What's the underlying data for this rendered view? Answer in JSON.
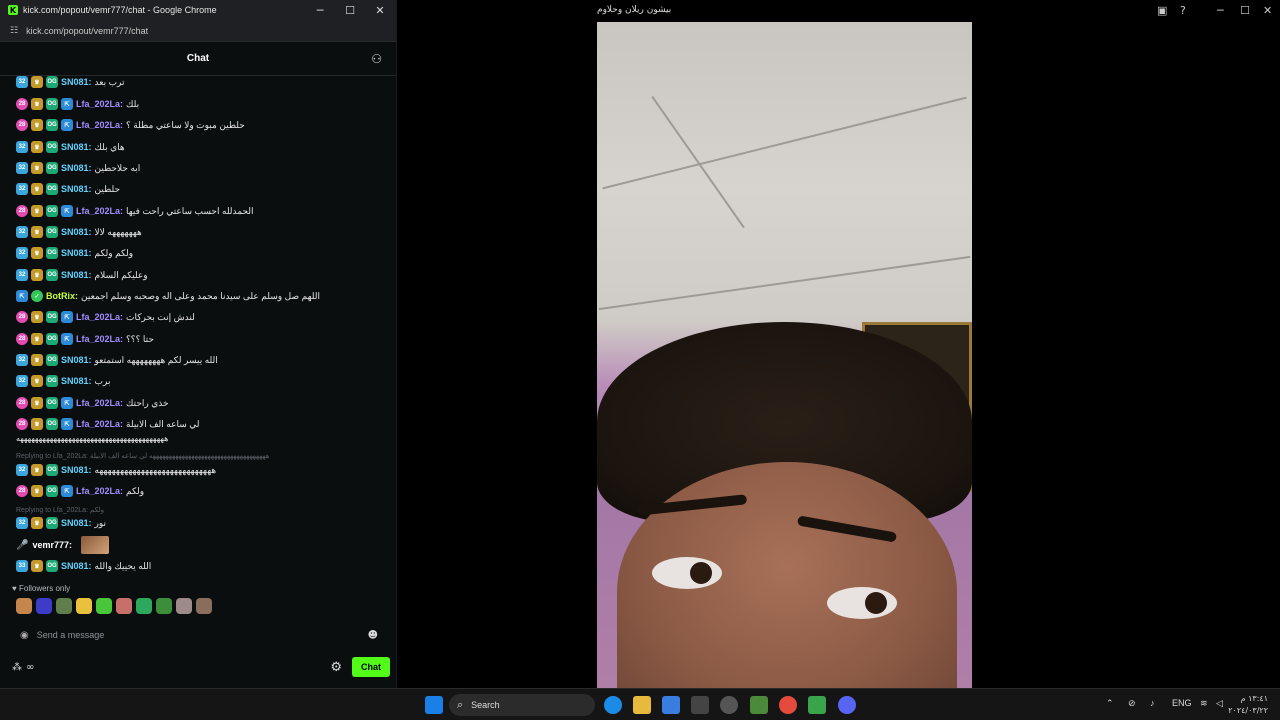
{
  "browser": {
    "title": "kick.com/popout/vemr777/chat - Google Chrome",
    "url": "kick.com/popout/vemr777/chat"
  },
  "chat": {
    "header": "Chat",
    "messages": [
      {
        "badge": "32",
        "user": "SN081:",
        "text": "ترب بعد",
        "type": "sno"
      },
      {
        "badge": "28",
        "user": "Lfa_202La:",
        "text": "بلك",
        "type": "lfa"
      },
      {
        "badge": "28",
        "user": "Lfa_202La:",
        "text": "حلطين مبوت ولا ساعتي مطلة ؟",
        "type": "lfa"
      },
      {
        "badge": "32",
        "user": "SN081:",
        "text": "هاي بلك",
        "type": "sno"
      },
      {
        "badge": "32",
        "user": "SN081:",
        "text": "ابه حلاحطين",
        "type": "sno"
      },
      {
        "badge": "32",
        "user": "SN081:",
        "text": "حلطين",
        "type": "sno"
      },
      {
        "badge": "28",
        "user": "Lfa_202La:",
        "text": "الحمدلله احسب ساعتي راحت فيها",
        "type": "lfa"
      },
      {
        "badge": "32",
        "user": "SN081:",
        "text": "هههههههه لالا",
        "type": "sno"
      },
      {
        "badge": "32",
        "user": "SN081:",
        "text": "ولكم ولكم",
        "type": "sno"
      },
      {
        "badge": "32",
        "user": "SN081:",
        "text": "وعليكم السلام",
        "type": "sno"
      },
      {
        "badge": "",
        "user": "BotRix:",
        "text": "اللهم صل وسلم على سيدنا محمد وعلى اله وصحبه وسلم اجمعين",
        "type": "bot"
      },
      {
        "badge": "28",
        "user": "Lfa_202La:",
        "text": "لندش إنت بحركات",
        "type": "lfa"
      },
      {
        "badge": "28",
        "user": "Lfa_202La:",
        "text": "حتا ؟؟؟",
        "type": "lfa"
      },
      {
        "badge": "32",
        "user": "SN081:",
        "text": "الله ييسر لكم ههههههههه استمتعو",
        "type": "sno"
      },
      {
        "badge": "32",
        "user": "SN081:",
        "text": "برب",
        "type": "sno"
      },
      {
        "badge": "28",
        "user": "Lfa_202La:",
        "text": "خذي راحتك",
        "type": "lfa"
      },
      {
        "badge": "28",
        "user": "Lfa_202La:",
        "text": "لي ساعه الف الابيلة",
        "type": "lfa"
      }
    ],
    "wrapped_line": "ههههههههههههههههههههههههههههههههههههههههه",
    "reply1": "Replying to Lfa_202La: ههههههههههههههههههههههههههههههههههههه لي ساعه الف الابيلة",
    "reply1_msg": {
      "badge": "32",
      "user": "SN081:",
      "text": "ههههههههههههههههههههههههههههه"
    },
    "msg_after_reply1": {
      "badge": "28",
      "user": "Lfa_202La:",
      "text": "ولكم"
    },
    "reply2": "Replying to Lfa_202La: ولكم",
    "reply2_msg": {
      "badge": "32",
      "user": "SN081:",
      "text": "نور"
    },
    "streamer_msg": {
      "user": "vemr777:"
    },
    "last_msg": {
      "badge": "33",
      "user": "SN081:",
      "text": "الله يحييك والله"
    },
    "followers_only": "Followers only",
    "input_placeholder": "Send a message",
    "chat_button": "Chat",
    "points": "∞"
  },
  "video": {
    "title": "بيشون ريلان وحلاوم"
  },
  "taskbar": {
    "search": "Search",
    "lang": "ENG",
    "time": "١٣:٤١ م",
    "date": "٢٠٢٤/٠٣/٢٢"
  },
  "colors": {
    "kick_green": "#53fc18",
    "sno_name": "#62d3ff",
    "lfa_name": "#a38cff",
    "bot_name": "#c8ff3a"
  }
}
